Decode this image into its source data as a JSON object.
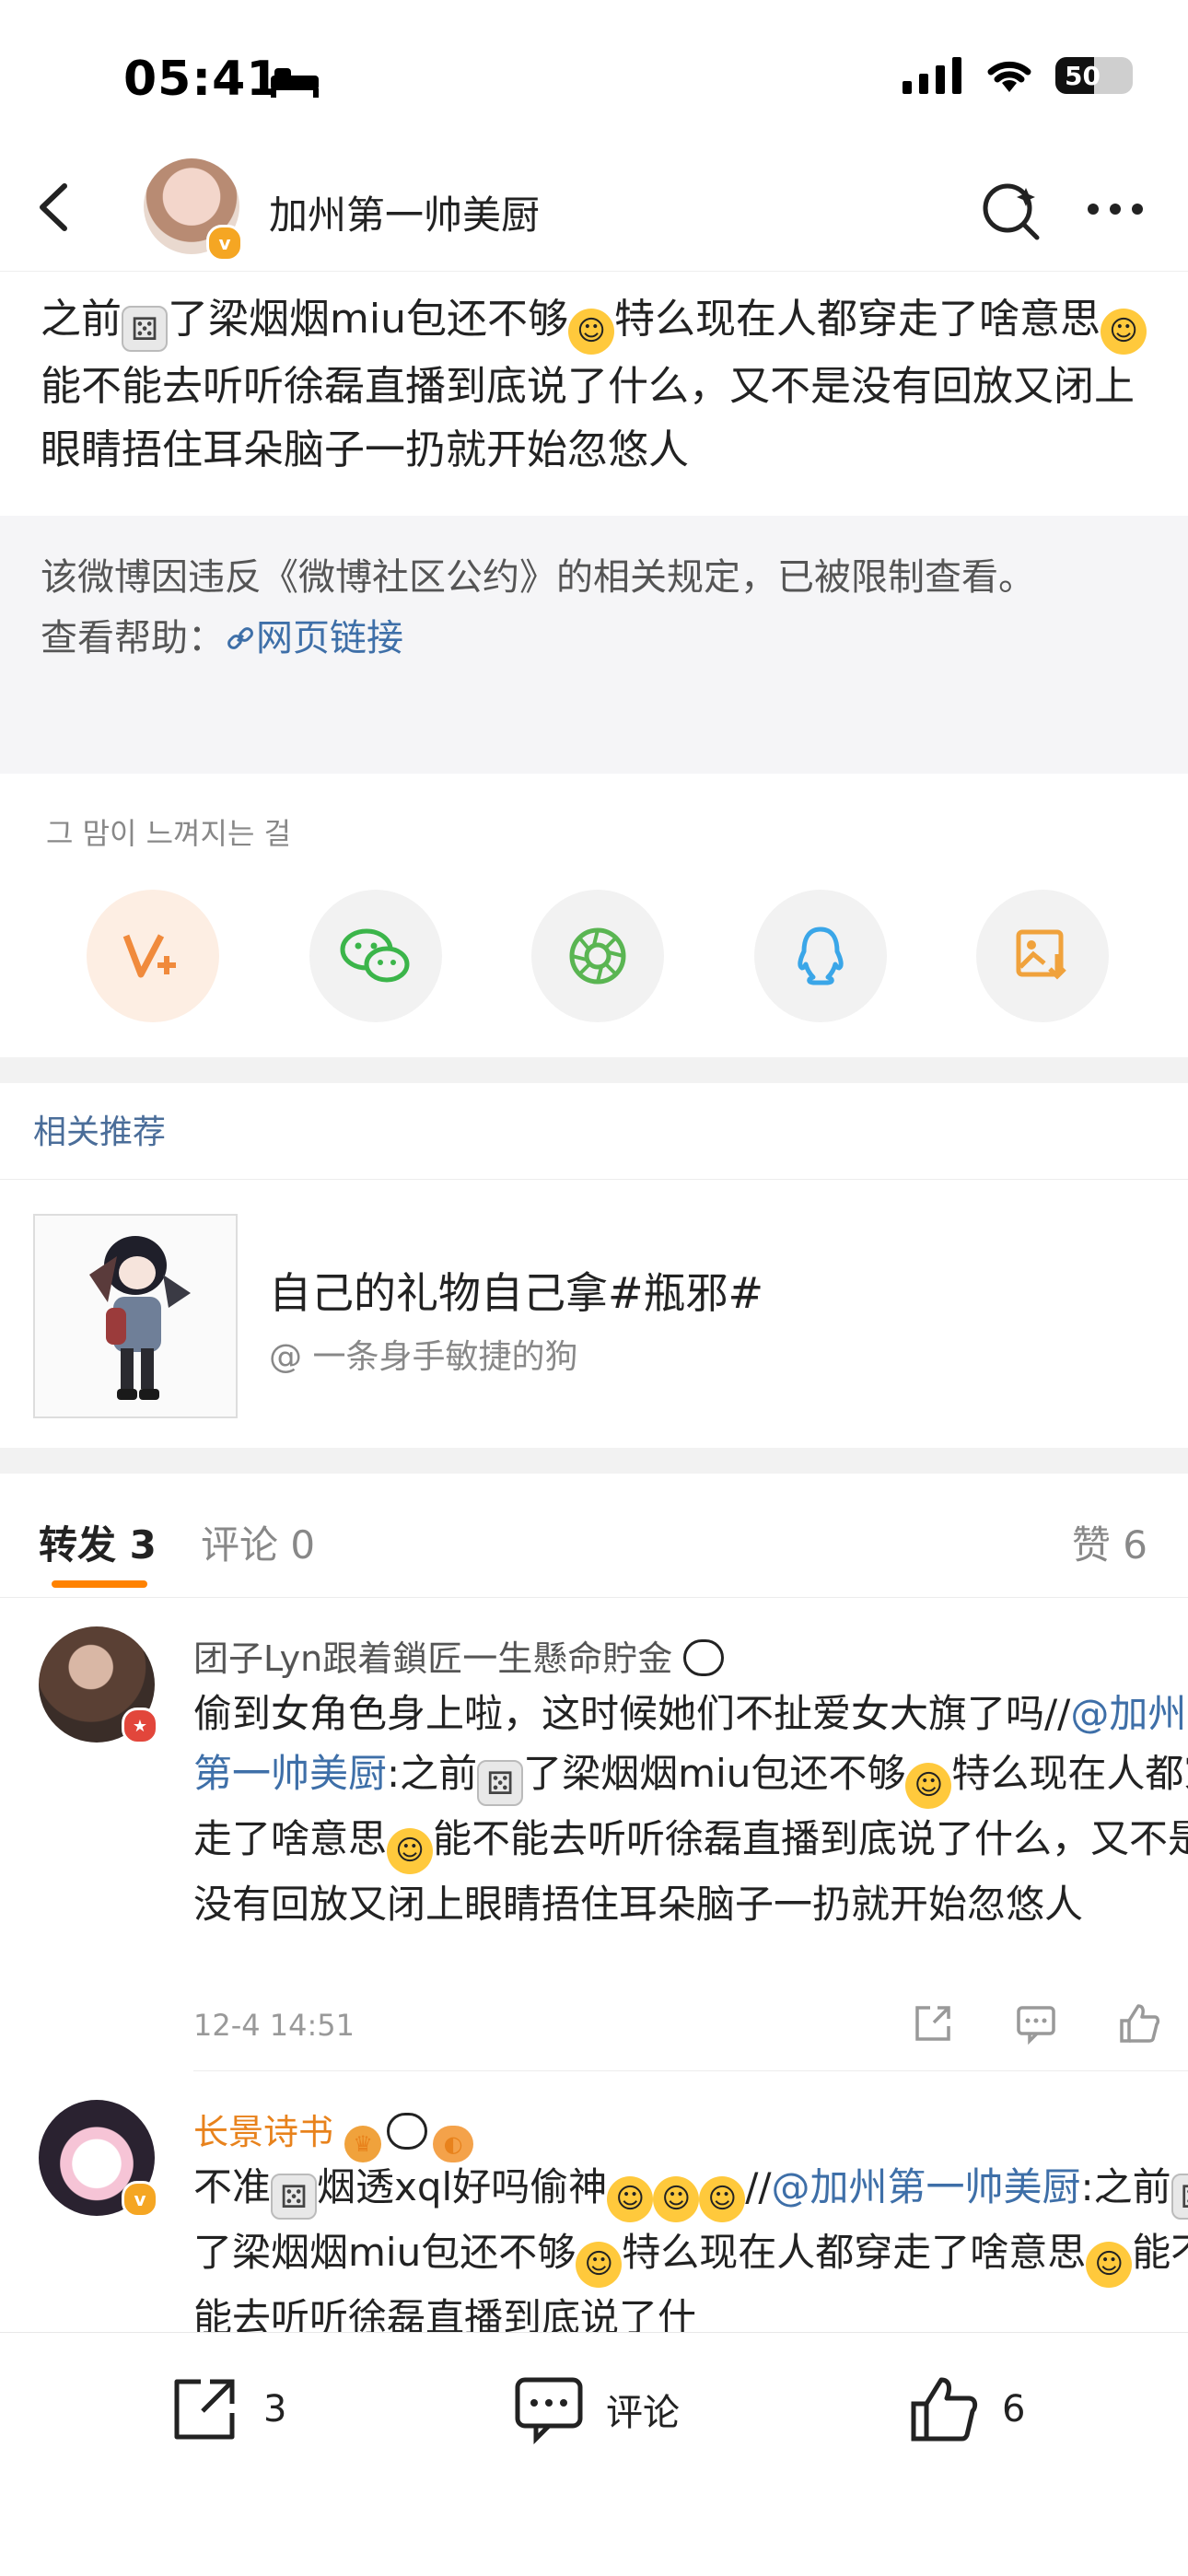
{
  "status_bar": {
    "time": "05:41",
    "battery": "50"
  },
  "header": {
    "title": "加州第一帅美厨",
    "verified_badge": "v"
  },
  "post": {
    "text_1": "之前",
    "text_2": "了梁烟烟miu包还不够",
    "text_3": "特么现在人都穿走了啥意思",
    "text_4": "能不能去听听徐磊直播到底说了什么，又不是没有回放又闭上眼睛捂住耳朵脑子一扔就开始忽悠人"
  },
  "restriction": {
    "notice": "该微博因违反《微博社区公约》的相关规定，已被限制查看。",
    "help_label": "查看帮助：",
    "help_link": "网页链接"
  },
  "share": {
    "caption": "그 맘이 느껴지는 걸",
    "buttons": [
      {
        "icon": "weibo-v-plus-icon",
        "color": "#f08a3c"
      },
      {
        "icon": "wechat-icon",
        "color": "#3bb54a"
      },
      {
        "icon": "moments-icon",
        "color": "#5ab552"
      },
      {
        "icon": "qq-icon",
        "color": "#3aa6e8"
      },
      {
        "icon": "save-image-icon",
        "color": "#f0a23c"
      }
    ]
  },
  "recommend": {
    "section_title": "相关推荐",
    "title": "自己的礼物自己拿#瓶邪#",
    "author": "@ 一条身手敏捷的狗"
  },
  "tabs": {
    "repost_label": "转发",
    "repost_count": "3",
    "comment_label": "评论",
    "comment_count": "0",
    "like_label": "赞",
    "like_count": "6"
  },
  "reposts": [
    {
      "name": "团子Lyn跟着鎖匠一生懸命貯金",
      "text_1": "偷到女角色身上啦，这时候她们不扯爱女大旗了吗//",
      "mention": "@加州第一帅美厨",
      "text_2": ":之前",
      "text_3": "了梁烟烟miu包还不够",
      "text_4": "特么现在人都穿走了啥意思",
      "text_5": "能不能去听听徐磊直播到底说了什么，又不是没有回放又闭上眼睛捂住耳朵脑子一扔就开始忽悠人",
      "time": "12-4 14:51"
    },
    {
      "name": "长景诗书",
      "text_1": "不准",
      "text_2": "烟透xql好吗偷神",
      "text_3": "//",
      "mention": "@加州第一帅美厨",
      "text_4": ":之前",
      "text_5": "了梁烟烟miu包还不够",
      "text_6": "特么现在人都穿走了啥意思",
      "text_7": "能不能去听听徐磊直播到底说了什"
    }
  ],
  "bottom_bar": {
    "repost_count": "3",
    "comment_label": "评论",
    "like_count": "6"
  },
  "colors": {
    "accent": "#ff8200",
    "link": "#3e6fa8",
    "orange_name": "#e8821c"
  }
}
